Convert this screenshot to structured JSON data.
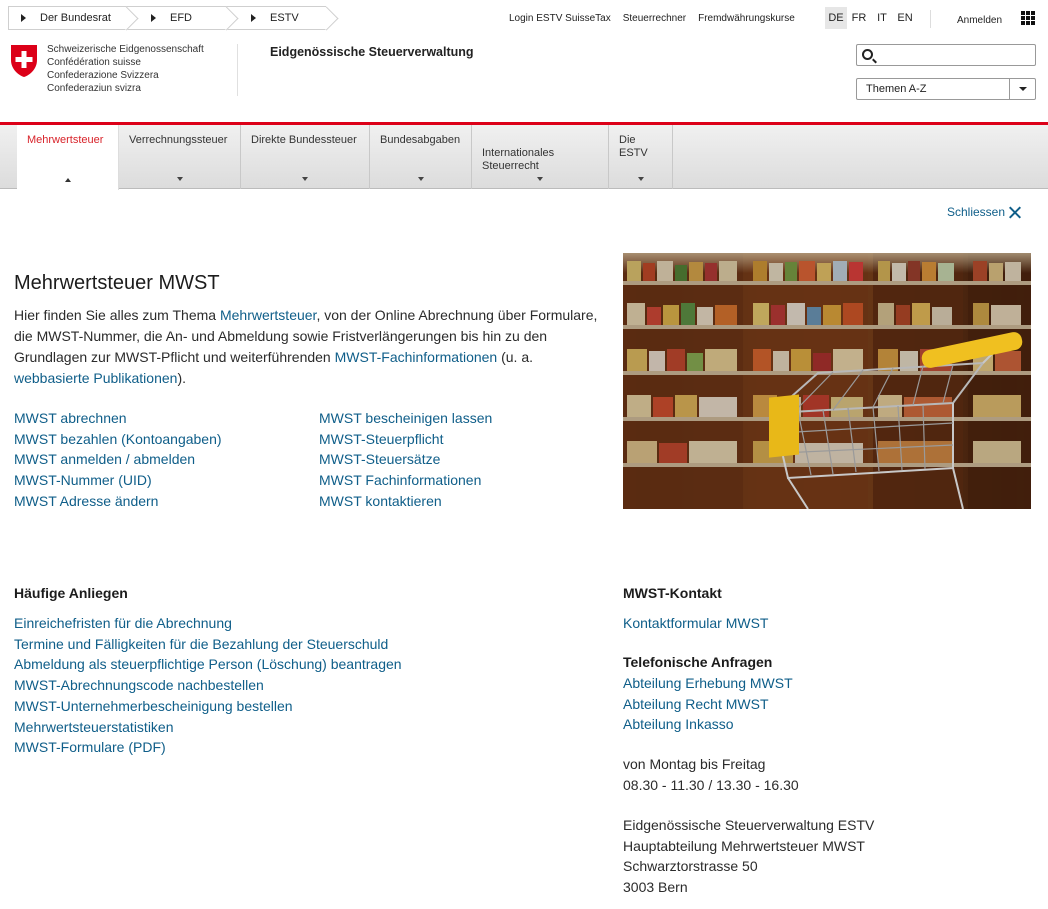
{
  "breadcrumb": [
    "Der Bundesrat",
    "EFD",
    "ESTV"
  ],
  "services": [
    "Login ESTV SuisseTax",
    "Steuerrechner",
    "Fremdwährungskurse"
  ],
  "languages": [
    {
      "code": "DE",
      "active": true
    },
    {
      "code": "FR",
      "active": false
    },
    {
      "code": "IT",
      "active": false
    },
    {
      "code": "EN",
      "active": false
    }
  ],
  "login_label": "Anmelden",
  "confederation": [
    "Schweizerische Eidgenossenschaft",
    "Confédération suisse",
    "Confederazione Svizzera",
    "Confederaziun svizra"
  ],
  "department": "Eidgenössische Steuerverwaltung",
  "search": {
    "placeholder": "",
    "value": ""
  },
  "themen_select": "Themen A-Z",
  "nav": [
    {
      "label": "Mehrwertsteuer",
      "active": true
    },
    {
      "label": "Verrechnungssteuer",
      "active": false
    },
    {
      "label": "Direkte Bundessteuer",
      "active": false
    },
    {
      "label": "Bundesabgaben",
      "active": false
    },
    {
      "label": "Internationales\nSteuerrecht",
      "active": false
    },
    {
      "label": "Die ESTV",
      "active": false
    }
  ],
  "close_label": "Schliessen",
  "main": {
    "title": "Mehrwertsteuer MWST",
    "intro": {
      "t1": "Hier finden Sie alles zum Thema ",
      "l1": "Mehrwertsteuer",
      "t2": ", von der Online Abrechnung über Formulare, die MWST-Nummer, die An- und Abmeldung sowie Fristverlängerungen bis hin zu den Grundlagen zur MWST-Pflicht und weiterführenden ",
      "l2": "MWST-Fachinformationen",
      "t3": " (u. a. ",
      "l3": "webbasierte Publikationen",
      "t4": ")."
    },
    "links_left": [
      "MWST abrechnen",
      "MWST bezahlen (Kontoangaben)",
      "MWST anmelden / abmelden",
      "MWST-Nummer (UID)",
      "MWST Adresse ändern"
    ],
    "links_right": [
      "MWST bescheinigen lassen",
      "MWST-Steuerpflicht",
      "MWST-Steuersätze",
      "MWST Fachinformationen",
      "MWST kontaktieren"
    ]
  },
  "faq": {
    "title": "Häufige Anliegen",
    "links": [
      "Einreichefristen für die Abrechnung",
      "Termine und Fälligkeiten für die Bezahlung der Steuerschuld",
      "Abmeldung als steuerpflichtige Person (Löschung) beantragen",
      "MWST-Abrechnungscode nachbestellen",
      "MWST-Unternehmerbescheinigung bestellen",
      "Mehrwertsteuerstatistiken",
      "MWST-Formulare (PDF)"
    ]
  },
  "contact": {
    "title": "MWST-Kontakt",
    "form_link": "Kontaktformular MWST",
    "phone_heading": "Telefonische Anfragen",
    "phone_links": [
      "Abteilung Erhebung MWST",
      "Abteilung Recht MWST",
      "Abteilung Inkasso"
    ],
    "hours": [
      "von Montag bis Freitag",
      "08.30 - 11.30 / 13.30 - 16.30"
    ],
    "address": [
      "Eidgenössische Steuerverwaltung ESTV",
      "Hauptabteilung Mehrwertsteuer MWST",
      "Schwarztorstrasse 50",
      "3003 Bern"
    ]
  },
  "colors": {
    "link": "#0f5e89",
    "accent_red": "#dc0018",
    "nav_active": "#d8232a"
  },
  "icons": [
    "play-icon",
    "grid-menu-icon",
    "swiss-coat-of-arms-icon",
    "search-icon",
    "chevron-down-icon",
    "close-icon"
  ]
}
